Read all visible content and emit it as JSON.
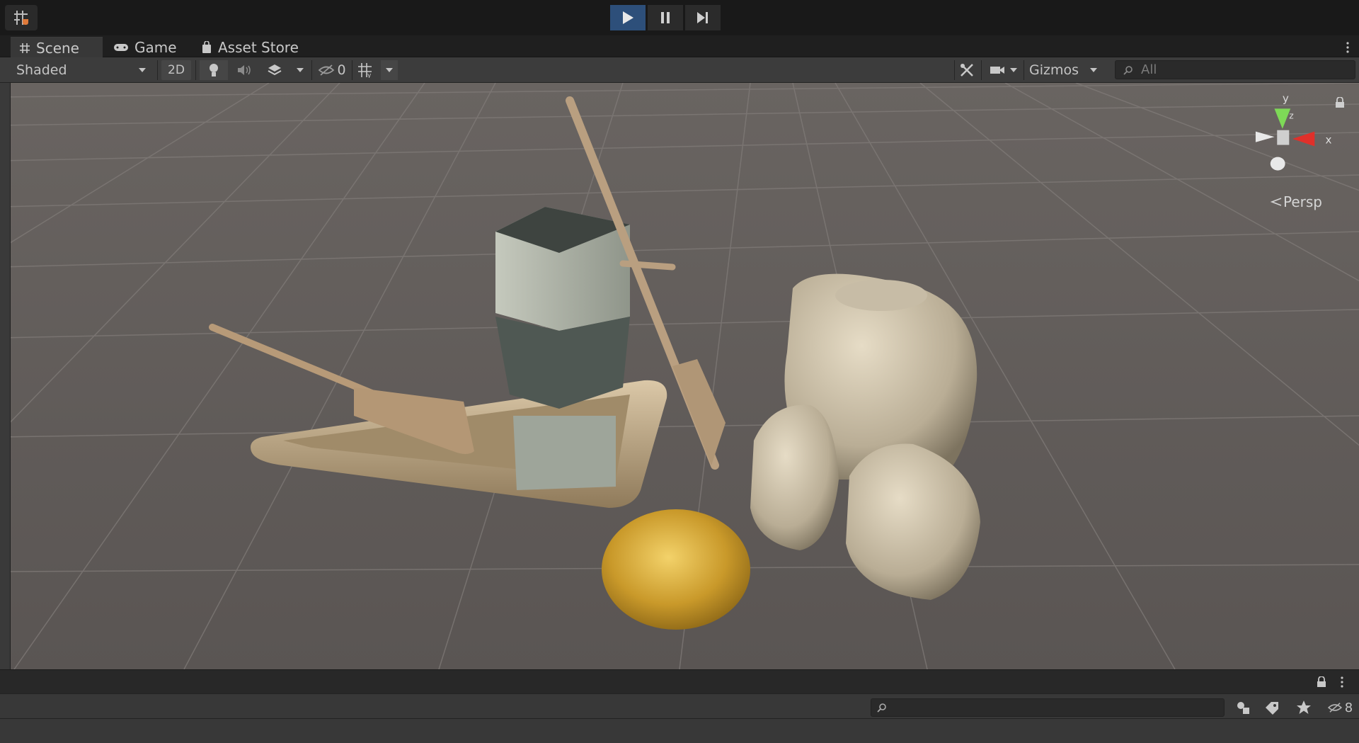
{
  "play_controls": {
    "play_icon": "play-icon",
    "pause_icon": "pause-icon",
    "step_icon": "step-icon"
  },
  "tabs": [
    {
      "label": "Scene",
      "icon": "scene-grid-icon"
    },
    {
      "label": "Game",
      "icon": "gamepad-icon"
    },
    {
      "label": "Asset Store",
      "icon": "bag-icon"
    }
  ],
  "toolbar": {
    "draw_mode": "Shaded",
    "mode_2d": "2D",
    "hidden_count": "0",
    "gizmos_label": "Gizmos",
    "search_placeholder": "All"
  },
  "orientation_gizmo": {
    "y_label": "y",
    "z_label": "z",
    "x_label": "x",
    "projection_label": "Persp"
  },
  "project_panel": {
    "hidden_count": "8"
  },
  "colors": {
    "play_active": "#2d4f7a",
    "viewport_bg": "#5e5957",
    "axis_x": "#e0302a",
    "axis_y": "#7ed957",
    "axis_z": "#3d7fe0"
  }
}
